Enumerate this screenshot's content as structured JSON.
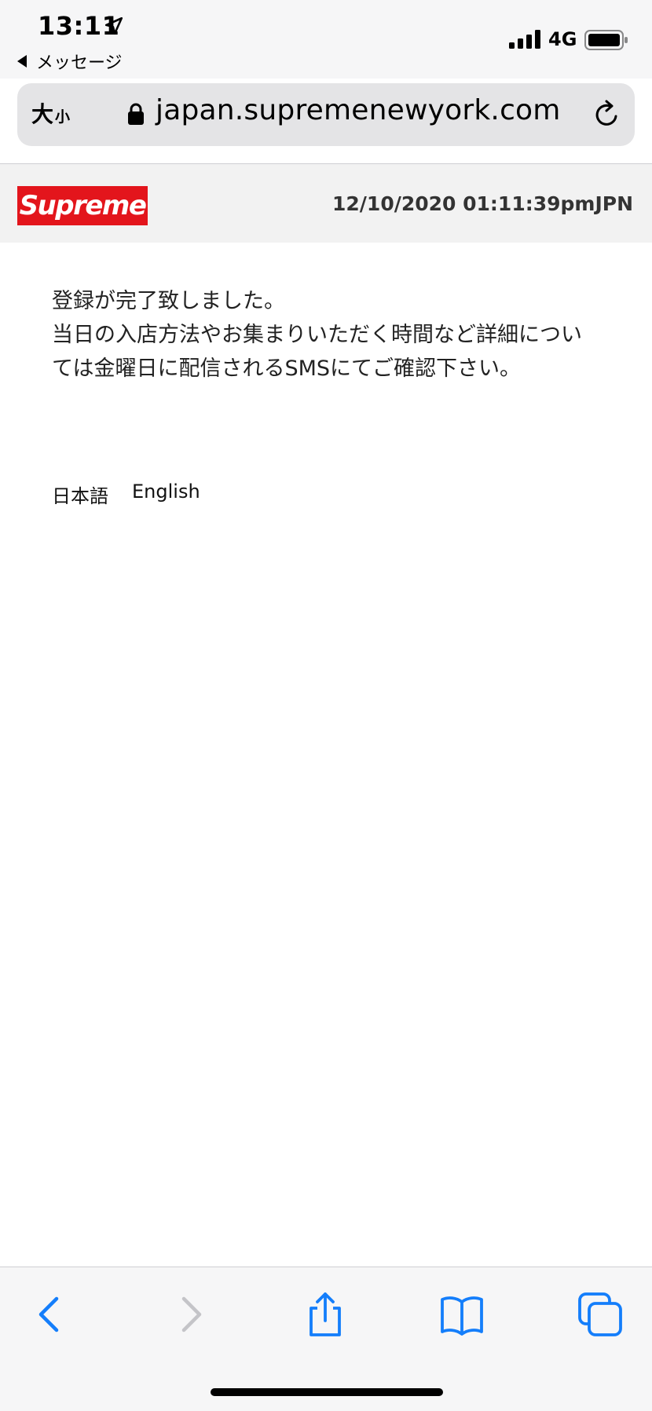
{
  "status_bar": {
    "time": "13:11",
    "back_app": "メッセージ",
    "network": "4G"
  },
  "browser": {
    "text_size_big": "大",
    "text_size_small": "小",
    "url": "japan.supremenewyork.com"
  },
  "site": {
    "logo_text": "Supreme",
    "timestamp": "12/10/2020 01:11:39pmJPN",
    "message_lines": [
      "登録が完了致しました。",
      "当日の入店方法やお集まりいただく時間など詳細については金曜日に配信されるSMSにてご確認下さい。"
    ],
    "languages": [
      "日本語",
      "English"
    ]
  },
  "colors": {
    "accent": "#147efb",
    "brand_red": "#e3151c"
  }
}
